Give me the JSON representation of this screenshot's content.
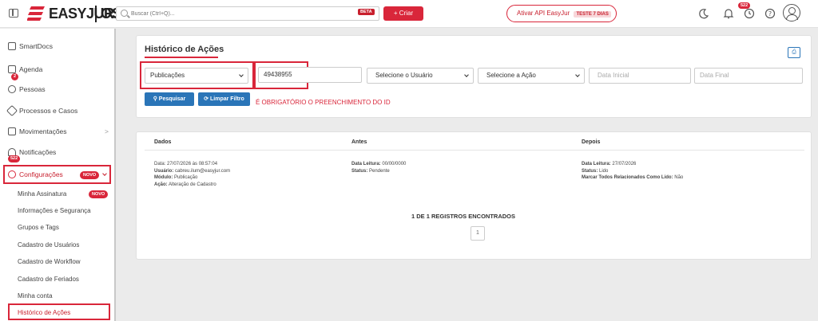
{
  "header": {
    "logo_text": "EASYJUR.",
    "logo_os": "OS",
    "search_placeholder": "Buscar (Ctrl+Q)...",
    "beta_badge": "BETA",
    "create_button": "+ Criar",
    "activate_api_label": "Ativar API EasyJur",
    "trial_badge": "TESTE 7 DIAS",
    "notifications_count": "522"
  },
  "sidebar": {
    "top_items": [
      {
        "label": "SmartDocs",
        "icon": "document-icon"
      },
      {
        "label": "Agenda",
        "icon": "calendar-icon",
        "badge": "2"
      },
      {
        "label": "Pessoas",
        "icon": "people-icon"
      },
      {
        "label": "Processos e Casos",
        "icon": "gavel-icon"
      },
      {
        "label": "Movimentações",
        "icon": "movements-icon",
        "arrow": ">"
      },
      {
        "label": "Notificações",
        "icon": "bell-icon",
        "badge": "522"
      },
      {
        "label": "Configurações",
        "icon": "gear-icon",
        "badge": "NOVO"
      }
    ],
    "sub_items": [
      {
        "label": "Minha Assinatura",
        "badge": "NOVO"
      },
      {
        "label": "Informações e Segurança"
      },
      {
        "label": "Grupos e Tags"
      },
      {
        "label": "Cadastro de Usuários"
      },
      {
        "label": "Cadastro de Workflow"
      },
      {
        "label": "Cadastro de Feriados"
      },
      {
        "label": "Minha conta"
      },
      {
        "label": "Histórico de Ações"
      }
    ]
  },
  "filters": {
    "title": "Histórico de Ações",
    "module_select": "Publicações",
    "id_value": "49438955",
    "user_select": "Selecione o Usuário",
    "action_select": "Selecione a Ação",
    "start_date_placeholder": "Data Inicial",
    "end_date_placeholder": "Data Final",
    "search_button": "Pesquisar",
    "clear_button": "Limpar Filtro",
    "warning": "É OBRIGATÓRIO O PREENCHIMENTO DO ID"
  },
  "results": {
    "columns": [
      "Dados",
      "Antes",
      "Depois"
    ],
    "row": {
      "dados": [
        {
          "k": "",
          "v": "Data: 27/07/2026 às 08:57:04"
        },
        {
          "k": "Usuário:",
          "v": " cabreu.ilum@easyjur.com"
        },
        {
          "k": "Módulo:",
          "v": " Publicação"
        },
        {
          "k": "Ação:",
          "v": " Alteração de Cadastro"
        }
      ],
      "antes": [
        {
          "k": "Data Leitura:",
          "v": " 00/00/0000"
        },
        {
          "k": "Status:",
          "v": " Pendente"
        }
      ],
      "depois": [
        {
          "k": "Data Leitura:",
          "v": " 27/07/2026"
        },
        {
          "k": "Status:",
          "v": " Lido"
        },
        {
          "k": "Marcar Todos Relacionados Como Lido:",
          "v": " Não"
        }
      ]
    },
    "records_found": "1 DE 1 REGISTROS ENCONTRADOS",
    "current_page": "1"
  },
  "colors": {
    "accent_red": "#d9263a",
    "primary_blue": "#2a75b8"
  }
}
